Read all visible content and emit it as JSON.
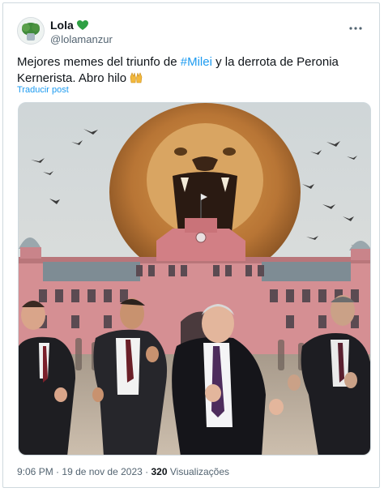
{
  "post": {
    "author": {
      "display_name": "Lola",
      "verified_badge": "green-heart-icon",
      "handle": "@lolamanzur"
    },
    "text_before": "Mejores memes del triunfo de ",
    "hashtag": "#Milei",
    "text_after": " y la derrota de Peronia Kernerista. Abro hilo",
    "emoji": "raised-hands-icon",
    "translate_label": "Traducir post",
    "media": {
      "description_icon": "meme-image"
    },
    "time": "9:06 PM",
    "separator": "·",
    "date": "19 de nov de 2023",
    "views_count": "320",
    "views_label": "Visualizações"
  },
  "colors": {
    "link": "#1d9bf0",
    "secondary_text": "#536471",
    "palace_pink": "#d58f93",
    "heart_green": "#2ea043"
  }
}
